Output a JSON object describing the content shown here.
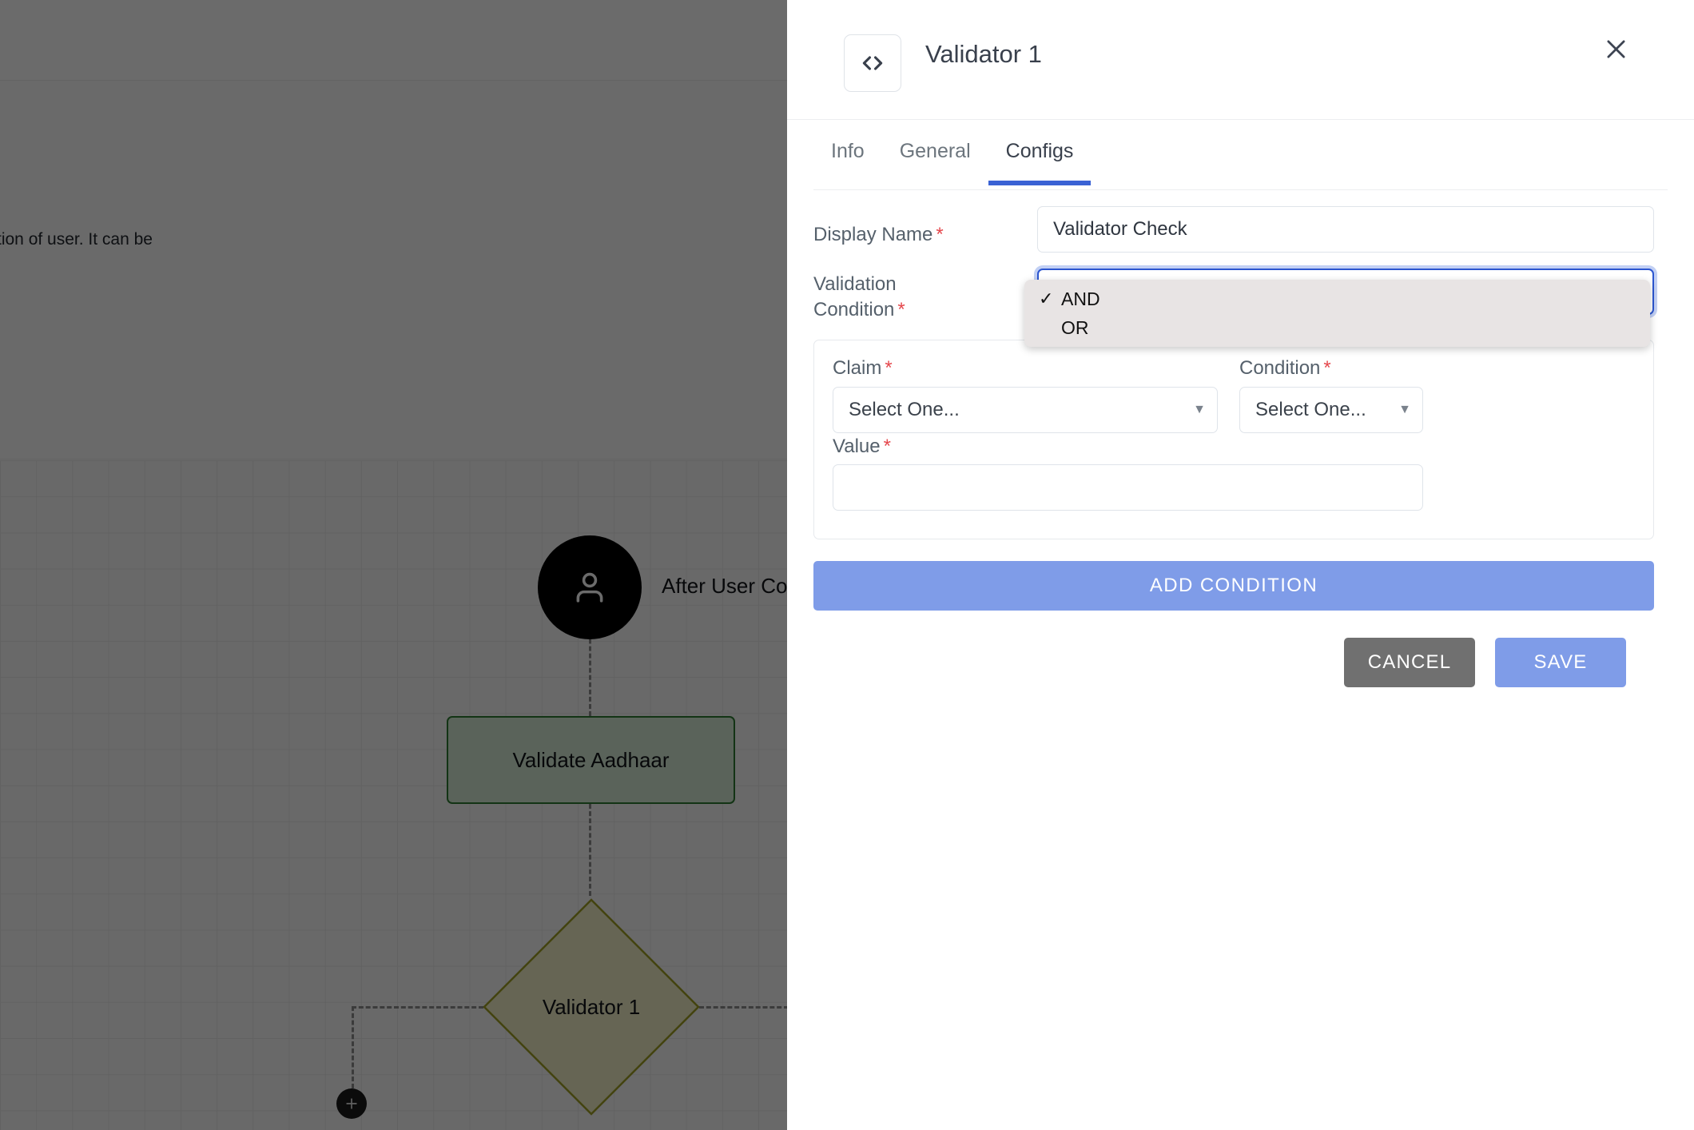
{
  "canvas": {
    "description_fragment": "tion of user. It can be",
    "nodes": [
      {
        "id": "user-node",
        "type": "circle",
        "icon": "user-icon",
        "label": "After User Co"
      },
      {
        "id": "validate-aadhaar",
        "type": "rect",
        "label": "Validate Aadhaar"
      },
      {
        "id": "validator-1",
        "type": "diamond",
        "label": "Validator 1"
      },
      {
        "id": "add-node",
        "type": "plus",
        "icon": "plus-icon"
      }
    ],
    "colors": {
      "rect_border": "#2f7d32",
      "diamond_border": "#a0a024",
      "edge": "#8c8c8c"
    }
  },
  "panel": {
    "icon": "code-icon",
    "title": "Validator 1",
    "close_label": "×",
    "tabs": [
      {
        "id": "info",
        "label": "Info",
        "active": false
      },
      {
        "id": "general",
        "label": "General",
        "active": false
      },
      {
        "id": "configs",
        "label": "Configs",
        "active": true
      }
    ],
    "accent_color": "#3a62d4",
    "form": {
      "display_name": {
        "label": "Display Name",
        "required_marker": "*",
        "value": "Validator Check",
        "placeholder": ""
      },
      "validation_condition": {
        "label_line1": "Validation",
        "label_line2": "Condition",
        "required_marker": "*",
        "selected": "AND",
        "options": [
          {
            "label": "AND",
            "checked": true,
            "check_glyph": "✓"
          },
          {
            "label": "OR",
            "checked": false,
            "check_glyph": ""
          }
        ]
      },
      "condition_card": {
        "claim": {
          "label": "Claim",
          "required_marker": "*",
          "value": "Select One...",
          "caret": "▼"
        },
        "condition": {
          "label": "Condition",
          "required_marker": "*",
          "value": "Select One...",
          "caret": "▼"
        },
        "value": {
          "label": "Value",
          "required_marker": "*",
          "value": "",
          "placeholder": ""
        }
      }
    },
    "buttons": {
      "add_condition": "ADD CONDITION",
      "cancel": "CANCEL",
      "save": "SAVE"
    },
    "button_colors": {
      "primary": "#7f9ce8",
      "cancel": "#707070"
    }
  }
}
